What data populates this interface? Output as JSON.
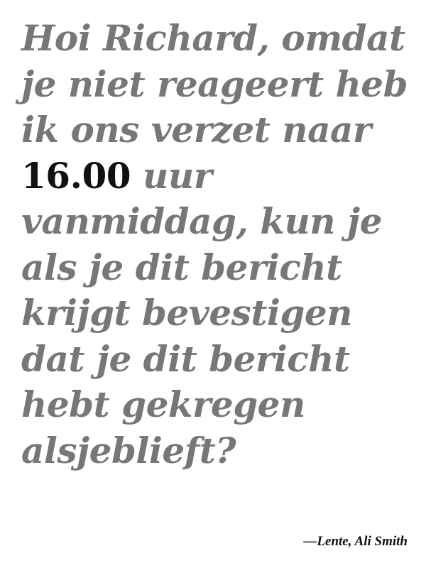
{
  "quote": {
    "line1": "Hoi Richard, omdat",
    "line2": "je  niet reageert heb",
    "line3": "ik ons verzet naar",
    "line4_time": "16.00",
    "line4_rest": "uur",
    "line5": "vanmiddag, kun je",
    "line6": "als je  dit bericht",
    "line7": "krijgt bevestigen",
    "line8": "dat je  dit bericht",
    "line9": "hebt gekregen",
    "line10": "alsjeblieft?"
  },
  "attribution": "—Lente, Ali Smith",
  "colors": {
    "quote_text": "#777777",
    "emphasis_text": "#111111",
    "background": "#ffffff"
  }
}
